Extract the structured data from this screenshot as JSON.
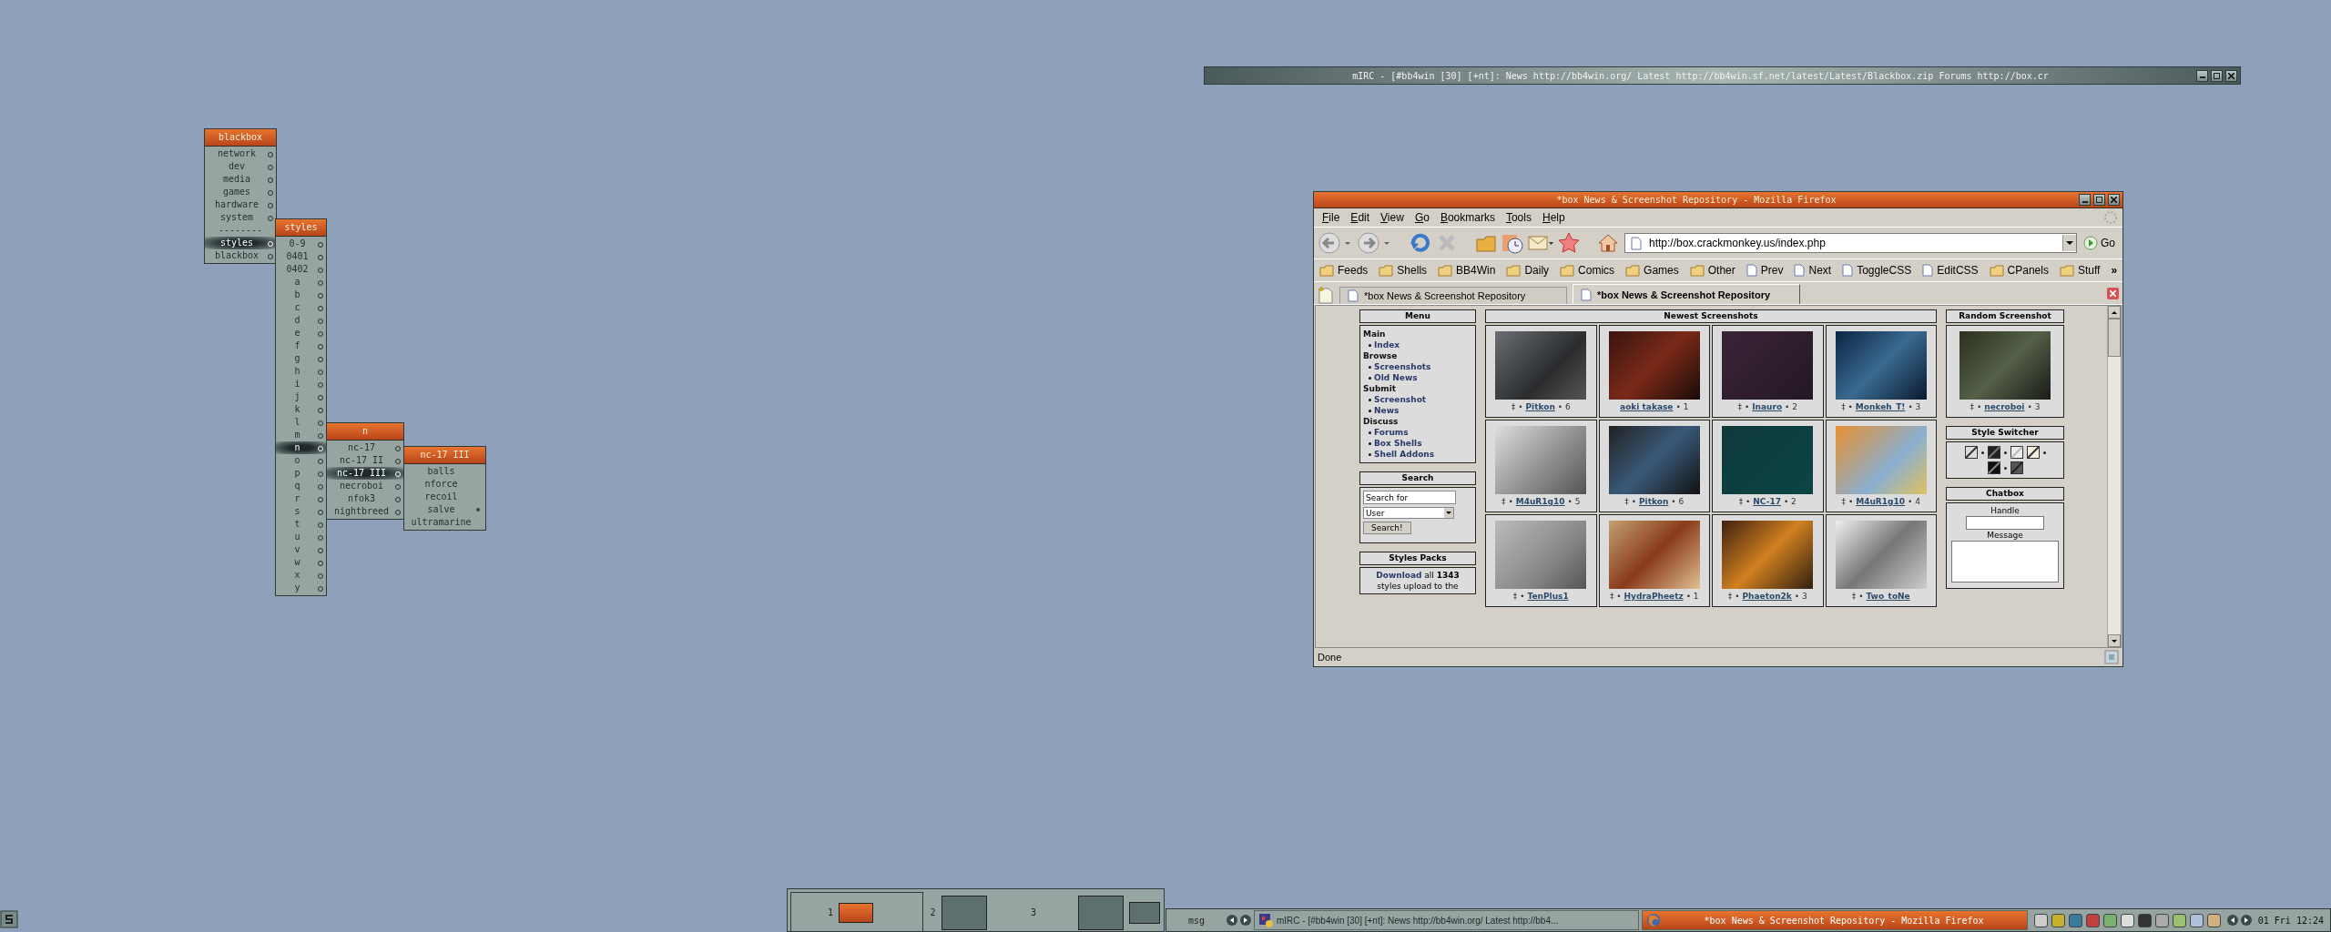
{
  "menus": [
    {
      "title": "blackbox",
      "items": [
        {
          "label": "network",
          "kind": "submenu",
          "selected": false
        },
        {
          "label": "dev",
          "kind": "submenu",
          "selected": false
        },
        {
          "label": "media",
          "kind": "submenu",
          "selected": false
        },
        {
          "label": "games",
          "kind": "submenu",
          "selected": false
        },
        {
          "label": "hardware",
          "kind": "submenu",
          "selected": false
        },
        {
          "label": "system",
          "kind": "submenu",
          "selected": false
        },
        {
          "label": "--------",
          "kind": "separator"
        },
        {
          "label": "styles",
          "kind": "submenu",
          "selected": true
        },
        {
          "label": "blackbox",
          "kind": "submenu",
          "selected": false
        }
      ]
    },
    {
      "title": "styles",
      "items": [
        {
          "label": "0-9",
          "kind": "submenu",
          "selected": false
        },
        {
          "label": "0401",
          "kind": "submenu",
          "selected": false
        },
        {
          "label": "0402",
          "kind": "submenu",
          "selected": false
        },
        {
          "label": "a",
          "kind": "submenu",
          "selected": false
        },
        {
          "label": "b",
          "kind": "submenu",
          "selected": false
        },
        {
          "label": "c",
          "kind": "submenu",
          "selected": false
        },
        {
          "label": "d",
          "kind": "submenu",
          "selected": false
        },
        {
          "label": "e",
          "kind": "submenu",
          "selected": false
        },
        {
          "label": "f",
          "kind": "submenu",
          "selected": false
        },
        {
          "label": "g",
          "kind": "submenu",
          "selected": false
        },
        {
          "label": "h",
          "kind": "submenu",
          "selected": false
        },
        {
          "label": "i",
          "kind": "submenu",
          "selected": false
        },
        {
          "label": "j",
          "kind": "submenu",
          "selected": false
        },
        {
          "label": "k",
          "kind": "submenu",
          "selected": false
        },
        {
          "label": "l",
          "kind": "submenu",
          "selected": false
        },
        {
          "label": "m",
          "kind": "submenu",
          "selected": false
        },
        {
          "label": "n",
          "kind": "submenu",
          "selected": true
        },
        {
          "label": "o",
          "kind": "submenu",
          "selected": false
        },
        {
          "label": "p",
          "kind": "submenu",
          "selected": false
        },
        {
          "label": "q",
          "kind": "submenu",
          "selected": false
        },
        {
          "label": "r",
          "kind": "submenu",
          "selected": false
        },
        {
          "label": "s",
          "kind": "submenu",
          "selected": false
        },
        {
          "label": "t",
          "kind": "submenu",
          "selected": false
        },
        {
          "label": "u",
          "kind": "submenu",
          "selected": false
        },
        {
          "label": "v",
          "kind": "submenu",
          "selected": false
        },
        {
          "label": "w",
          "kind": "submenu",
          "selected": false
        },
        {
          "label": "x",
          "kind": "submenu",
          "selected": false
        },
        {
          "label": "y",
          "kind": "submenu",
          "selected": false
        }
      ]
    },
    {
      "title": "n",
      "items": [
        {
          "label": "nc-17",
          "kind": "submenu",
          "selected": false
        },
        {
          "label": "nc-17 II",
          "kind": "submenu",
          "selected": false
        },
        {
          "label": "nc-17 III",
          "kind": "submenu",
          "selected": true
        },
        {
          "label": "necroboi",
          "kind": "submenu",
          "selected": false
        },
        {
          "label": "nfok3",
          "kind": "submenu",
          "selected": false
        },
        {
          "label": "nightbreed",
          "kind": "submenu",
          "selected": false
        }
      ]
    },
    {
      "title": "nc-17 III",
      "items": [
        {
          "label": "balls",
          "kind": "style",
          "selected": false,
          "checked": false
        },
        {
          "label": "nforce",
          "kind": "style",
          "selected": false,
          "checked": false
        },
        {
          "label": "recoil",
          "kind": "style",
          "selected": false,
          "checked": false
        },
        {
          "label": "salve",
          "kind": "style",
          "selected": false,
          "checked": true
        },
        {
          "label": "ultramarine",
          "kind": "style",
          "selected": false,
          "checked": false
        }
      ]
    }
  ],
  "mirc": {
    "title": "mIRC - [#bb4win [30] [+nt]: News http://bb4win.org/ Latest http://bb4win.sf.net/latest/Latest/Blackbox.zip Forums http://box.cr"
  },
  "firefox": {
    "title": "*box News & Screenshot Repository - Mozilla Firefox",
    "menu": [
      "File",
      "Edit",
      "View",
      "Go",
      "Bookmarks",
      "Tools",
      "Help"
    ],
    "url": "http://box.crackmonkey.us/index.php",
    "go": "Go",
    "bookmarks": [
      {
        "label": "Feeds",
        "kind": "folder"
      },
      {
        "label": "Shells",
        "kind": "folder"
      },
      {
        "label": "BB4Win",
        "kind": "folder"
      },
      {
        "label": "Daily",
        "kind": "folder"
      },
      {
        "label": "Comics",
        "kind": "folder"
      },
      {
        "label": "Games",
        "kind": "folder"
      },
      {
        "label": "Other",
        "kind": "folder"
      },
      {
        "label": "Prev",
        "kind": "page"
      },
      {
        "label": "Next",
        "kind": "page"
      },
      {
        "label": "ToggleCSS",
        "kind": "page"
      },
      {
        "label": "EditCSS",
        "kind": "page"
      },
      {
        "label": "CPanels",
        "kind": "folder"
      },
      {
        "label": "Stuff",
        "kind": "folder"
      }
    ],
    "bookmarks_more": "»",
    "tabs": [
      {
        "label": "*box News & Screenshot Repository",
        "selected": false
      },
      {
        "label": "*box News & Screenshot Repository",
        "selected": true
      }
    ],
    "page": {
      "menu": {
        "heading": "Menu",
        "sections": [
          {
            "heading": "Main",
            "links": [
              "Index"
            ]
          },
          {
            "heading": "Browse",
            "links": [
              "Screenshots",
              "Old News"
            ]
          },
          {
            "heading": "Submit",
            "links": [
              "Screenshot",
              "News"
            ]
          },
          {
            "heading": "Discuss",
            "links": [
              "Forums",
              "Box Shells",
              "Shell Addons"
            ]
          }
        ]
      },
      "search": {
        "heading": "Search",
        "value": "Search for",
        "select": "User",
        "button": "Search!"
      },
      "styles_packs": {
        "heading": "Styles Packs",
        "link": "Download",
        "text": "all **1343** styles upload to the"
      },
      "newest": {
        "heading": "Newest Screenshots",
        "shots": [
          {
            "prefix": "‡ •",
            "author": "Pitkon",
            "suffix": "• 6"
          },
          {
            "author": "aoki takase",
            "suffix": "• 1"
          },
          {
            "prefix": "‡ •",
            "author": "Inauro",
            "suffix": "• 2"
          },
          {
            "prefix": "‡ •",
            "author": "Monkeh_T!",
            "suffix": "• 3"
          },
          {
            "prefix": "‡ •",
            "author": "M4uR1g10",
            "suffix": "• 5"
          },
          {
            "prefix": "‡ •",
            "author": "Pitkon",
            "suffix": "• 6"
          },
          {
            "prefix": "‡ •",
            "author": "NC-17",
            "suffix": "• 2"
          },
          {
            "prefix": "‡ •",
            "author": "M4uR1g10",
            "suffix": "• 4"
          },
          {
            "prefix": "‡ •",
            "author": "TenPlus1"
          },
          {
            "prefix": "‡ •",
            "author": "HydraPheetz",
            "suffix": "• 1"
          },
          {
            "prefix": "‡ •",
            "author": "Phaeton2k",
            "suffix": "• 3"
          },
          {
            "prefix": "‡ •",
            "author": "Two_toNe"
          }
        ]
      },
      "random": {
        "heading": "Random Screenshot",
        "shot": {
          "prefix": "‡ •",
          "author": "necroboi",
          "suffix": "• 3"
        }
      },
      "style_switcher": {
        "heading": "Style Switcher"
      },
      "chatbox": {
        "heading": "Chatbox",
        "handle_label": "Handle",
        "message_label": "Message"
      }
    },
    "status": "Done"
  },
  "pager": {
    "desktops": [
      {
        "label": "1",
        "selected": true,
        "windows": [
          {
            "active": true
          }
        ]
      },
      {
        "label": "2",
        "selected": false,
        "windows": [
          {
            "active": false
          }
        ]
      },
      {
        "label": "3",
        "selected": false,
        "windows": [
          {
            "active": false
          },
          {
            "active": false
          }
        ]
      }
    ]
  },
  "taskbar": {
    "label": "msg",
    "tasks": [
      {
        "label": "mIRC - [#bb4win [30] [+nt]: News http://bb4win.org/ Latest http://bb4...",
        "selected": false
      },
      {
        "label": "*box News & Screenshot Repository - Mozilla Firefox",
        "selected": true
      }
    ],
    "clock": "01 Fri 12:24"
  }
}
